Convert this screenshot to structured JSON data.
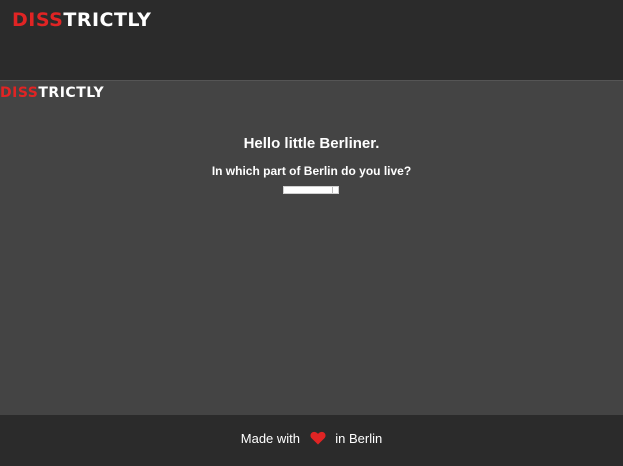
{
  "header": {
    "logo_accent": "DISS",
    "logo_rest": "TRICTLY"
  },
  "main": {
    "logo_accent": "DISS",
    "logo_rest": "TRICTLY",
    "greeting": "Hello little Berliner.",
    "question": "In which part of Berlin do you live?",
    "district_select": {
      "selected_value": ""
    }
  },
  "footer": {
    "prefix": "Made with",
    "suffix": "in Berlin",
    "heart_icon": "heart-icon"
  },
  "colors": {
    "accent": "#e02424",
    "header_bg": "#2b2b2b",
    "main_bg": "#444444",
    "text": "#ffffff"
  }
}
